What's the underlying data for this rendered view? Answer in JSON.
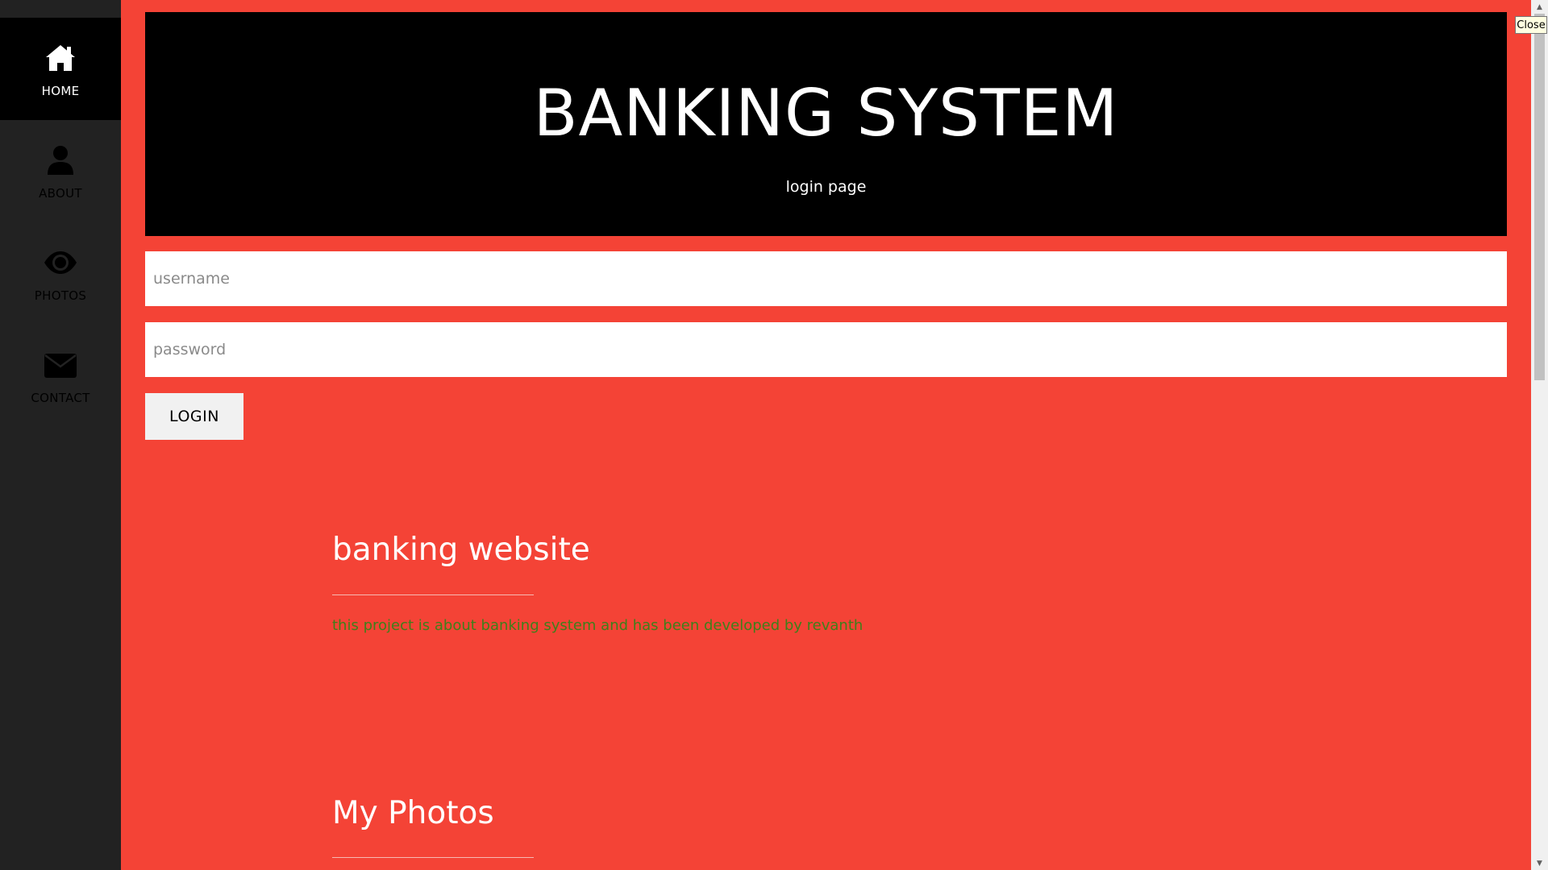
{
  "sidebar": {
    "items": [
      {
        "label": "HOME",
        "icon": "home-icon"
      },
      {
        "label": "ABOUT",
        "icon": "user-icon"
      },
      {
        "label": "PHOTOS",
        "icon": "eye-icon"
      },
      {
        "label": "CONTACT",
        "icon": "envelope-icon"
      }
    ]
  },
  "header": {
    "title": "BANKING SYSTEM",
    "subtitle": "login page"
  },
  "form": {
    "username_placeholder": "username",
    "password_placeholder": "password",
    "login_label": "LOGIN"
  },
  "about": {
    "title": "banking website",
    "text": "this project is about banking system and has been developed by revanth"
  },
  "photos": {
    "title": "My Photos"
  },
  "tooltip": {
    "close_label": "Close"
  },
  "colors": {
    "background": "#f44336",
    "sidebar": "#222222",
    "header": "#000000",
    "about_text": "#3f7f1a"
  }
}
